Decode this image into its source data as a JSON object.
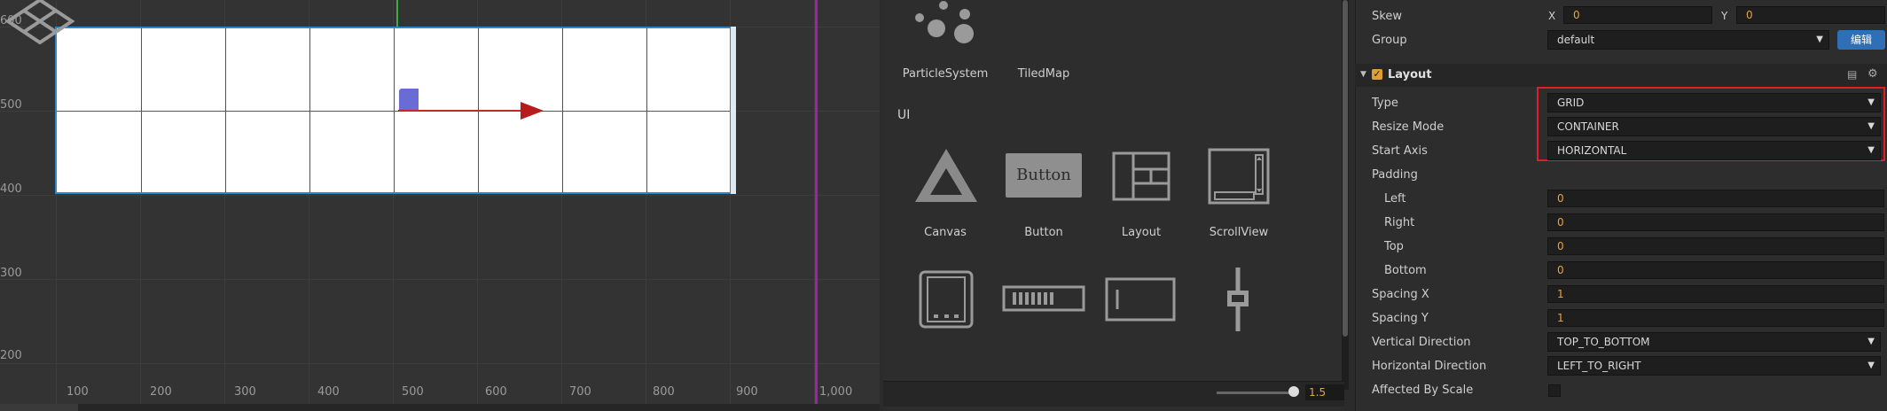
{
  "scene": {
    "y_labels": [
      {
        "text": "600"
      },
      {
        "text": "500"
      },
      {
        "text": "400"
      },
      {
        "text": "300"
      },
      {
        "text": "200"
      }
    ],
    "x_labels": [
      {
        "text": "100"
      },
      {
        "text": "200"
      },
      {
        "text": "300"
      },
      {
        "text": "400"
      },
      {
        "text": "500"
      },
      {
        "text": "600"
      },
      {
        "text": "700"
      },
      {
        "text": "800"
      },
      {
        "text": "900"
      },
      {
        "text": "1,000"
      }
    ]
  },
  "assets": {
    "items": [
      {
        "label": "ParticleSystem"
      },
      {
        "label": "TiledMap"
      },
      {
        "label": "Canvas"
      },
      {
        "label": "Button"
      },
      {
        "label": "Layout"
      },
      {
        "label": "ScrollView"
      }
    ],
    "section_ui": "UI",
    "button_preview_text": "Button",
    "zoom_value": "1.5"
  },
  "inspector": {
    "skew_label": "Skew",
    "skew_x_tag": "X",
    "skew_x": "0",
    "skew_y_tag": "Y",
    "skew_y": "0",
    "group_label": "Group",
    "group_value": "default",
    "edit_button": "编辑",
    "layout_title": "Layout",
    "rows": [
      {
        "label": "Type",
        "value": "GRID"
      },
      {
        "label": "Resize Mode",
        "value": "CONTAINER"
      },
      {
        "label": "Start Axis",
        "value": "HORIZONTAL"
      },
      {
        "label": "Padding",
        "value": ""
      },
      {
        "label": "Left",
        "value": "0"
      },
      {
        "label": "Right",
        "value": "0"
      },
      {
        "label": "Top",
        "value": "0"
      },
      {
        "label": "Bottom",
        "value": "0"
      },
      {
        "label": "Spacing X",
        "value": "1"
      },
      {
        "label": "Spacing Y",
        "value": "1"
      },
      {
        "label": "Vertical Direction",
        "value": "TOP_TO_BOTTOM"
      },
      {
        "label": "Horizontal Direction",
        "value": "LEFT_TO_RIGHT"
      },
      {
        "label": "Affected By Scale",
        "value": ""
      }
    ]
  },
  "colors": {
    "accent": "#2f6fb5",
    "highlight": "#e01e24",
    "number": "#e8a33d"
  }
}
